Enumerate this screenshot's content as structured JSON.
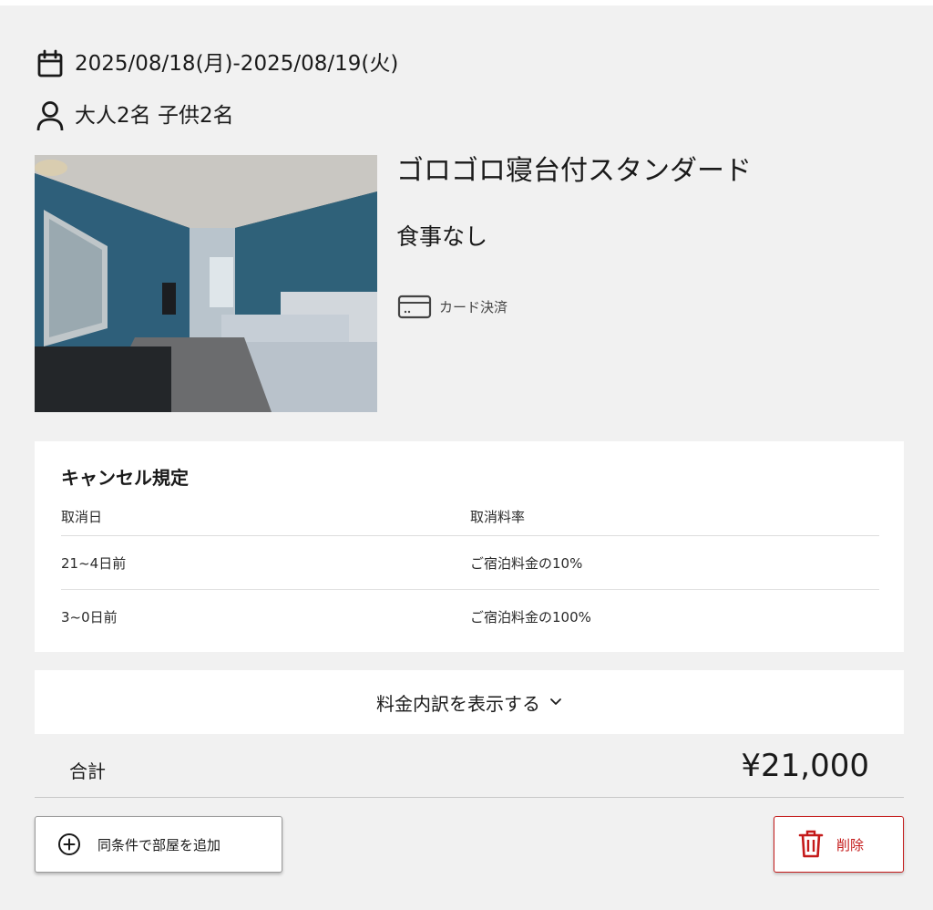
{
  "reservation": {
    "dates": "2025/08/18(月)-2025/08/19(火)",
    "guests": "大人2名 子供2名"
  },
  "room": {
    "name": "ゴロゴロ寝台付スタンダード",
    "meal": "食事なし",
    "payment_label": "カード決済",
    "photo": "hotel-room-photo"
  },
  "cancellation": {
    "title": "キャンセル規定",
    "headers": [
      "取消日",
      "取消料率"
    ],
    "rows": [
      [
        "21~4日前",
        "ご宿泊料金の10%"
      ],
      [
        "3~0日前",
        "ご宿泊料金の100%"
      ]
    ]
  },
  "breakdown": {
    "toggle_label": "料金内訳を表示する"
  },
  "total": {
    "label": "合計",
    "value": "¥21,000"
  },
  "actions": {
    "add_room_label": "同条件で部屋を追加",
    "delete_label": "削除"
  },
  "icons": {
    "dates": "calendar-icon",
    "guests": "person-icon",
    "payment": "credit-card-icon",
    "toggle": "chevron-down-icon",
    "add": "plus-circle-icon",
    "delete": "trash-icon"
  },
  "colors": {
    "background": "#f1f1f1",
    "card": "#ffffff",
    "text": "#1a1a1a",
    "danger": "#c41a1a",
    "divider": "#dcdcdc"
  }
}
